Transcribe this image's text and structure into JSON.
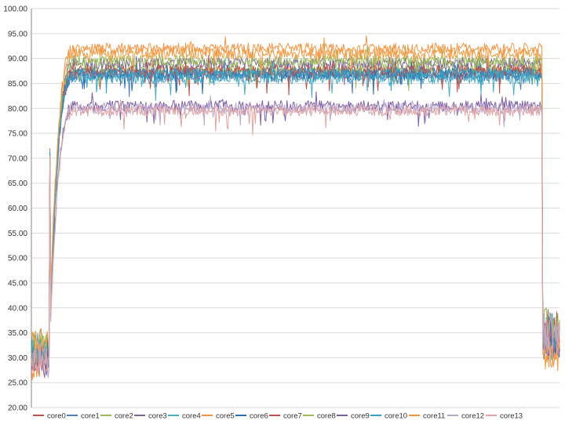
{
  "chart_data": {
    "type": "line",
    "title": "",
    "xlabel": "",
    "ylabel": "",
    "ylim": [
      20,
      100
    ],
    "yticks": [
      "20.00",
      "25.00",
      "30.00",
      "35.00",
      "40.00",
      "45.00",
      "50.00",
      "55.00",
      "60.00",
      "65.00",
      "70.00",
      "75.00",
      "80.00",
      "85.00",
      "90.00",
      "95.00",
      "100.00"
    ],
    "grid": true,
    "legend_position": "bottom",
    "x_count": 600,
    "phases": {
      "idle_start_end_index": 20,
      "ramp_end_index": 50,
      "load_end_index": 580
    },
    "series": [
      {
        "name": "core0",
        "color": "#c0504d",
        "idle": 30,
        "load": 87,
        "end": 35
      },
      {
        "name": "core1",
        "color": "#4f81bd",
        "idle": 31,
        "load": 86.5,
        "end": 34
      },
      {
        "name": "core2",
        "color": "#9bbb59",
        "idle": 32,
        "load": 88,
        "end": 36
      },
      {
        "name": "core3",
        "color": "#8064a2",
        "idle": 29,
        "load": 89,
        "end": 33
      },
      {
        "name": "core4",
        "color": "#4bacc6",
        "idle": 33,
        "load": 86,
        "end": 35
      },
      {
        "name": "core5",
        "color": "#f79646",
        "idle": 28,
        "load": 92,
        "end": 32
      },
      {
        "name": "core6",
        "color": "#2c6fae",
        "idle": 31,
        "load": 87,
        "end": 34
      },
      {
        "name": "core7",
        "color": "#c0504d",
        "idle": 30,
        "load": 87.5,
        "end": 36
      },
      {
        "name": "core8",
        "color": "#9bbb59",
        "idle": 32,
        "load": 89.5,
        "end": 35
      },
      {
        "name": "core9",
        "color": "#7e5ea7",
        "idle": 30,
        "load": 80.5,
        "end": 34
      },
      {
        "name": "core10",
        "color": "#31a3c6",
        "idle": 31,
        "load": 87,
        "end": 33
      },
      {
        "name": "core11",
        "color": "#f39a3e",
        "idle": 33,
        "load": 91,
        "end": 31
      },
      {
        "name": "core12",
        "color": "#b7a8d1",
        "idle": 29,
        "load": 80,
        "end": 35
      },
      {
        "name": "core13",
        "color": "#e2a4a2",
        "idle": 30,
        "load": 79.5,
        "end": 34
      }
    ]
  }
}
